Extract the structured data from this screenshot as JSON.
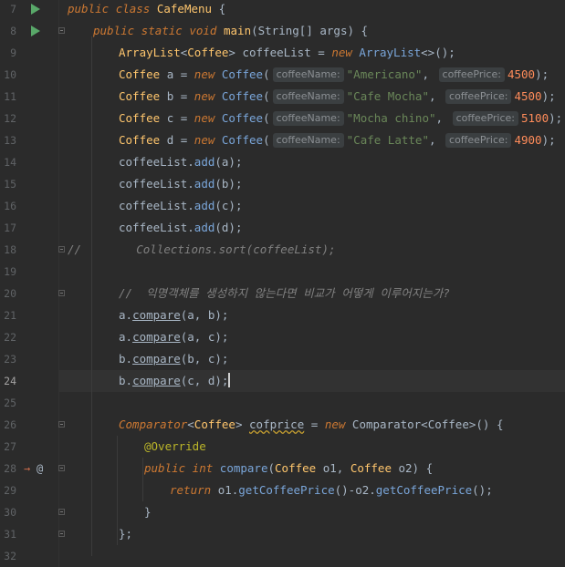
{
  "editor": {
    "current_line": 24,
    "lines": [
      {
        "n": "7",
        "tokens": [
          [
            "kw",
            "public "
          ],
          [
            "kw",
            "class "
          ],
          [
            "fn",
            "CafeMenu"
          ],
          [
            "gen",
            " {"
          ]
        ]
      },
      {
        "n": "8",
        "tokens": [
          [
            "kw",
            "public static void "
          ],
          [
            "fn",
            "main"
          ],
          [
            "gen",
            "(String[] args) {"
          ]
        ]
      },
      {
        "n": "9",
        "tokens": [
          [
            "typ",
            "ArrayList"
          ],
          [
            "gen",
            "<"
          ],
          [
            "typ",
            "Coffee"
          ],
          [
            "gen",
            "> coffeeList = "
          ],
          [
            "kw",
            "new "
          ],
          [
            "blue",
            "ArrayList"
          ],
          [
            "gen",
            "<>();"
          ]
        ]
      },
      {
        "n": "10",
        "tokens": [
          [
            "typ",
            "Coffee "
          ],
          [
            "gen",
            "a = "
          ],
          [
            "kw",
            "new "
          ],
          [
            "blue",
            "Coffee"
          ],
          [
            "gen",
            "("
          ],
          [
            "hint",
            "coffeeName:"
          ],
          [
            "str",
            "\"Americano\""
          ],
          [
            "gen",
            ", "
          ],
          [
            "hint",
            "coffeePrice:"
          ],
          [
            "num",
            "4500"
          ],
          [
            "gen",
            ");"
          ]
        ]
      },
      {
        "n": "11",
        "tokens": [
          [
            "typ",
            "Coffee "
          ],
          [
            "gen",
            "b = "
          ],
          [
            "kw",
            "new "
          ],
          [
            "blue",
            "Coffee"
          ],
          [
            "gen",
            "("
          ],
          [
            "hint",
            "coffeeName:"
          ],
          [
            "str",
            "\"Cafe Mocha\""
          ],
          [
            "gen",
            ", "
          ],
          [
            "hint",
            "coffeePrice:"
          ],
          [
            "num",
            "4500"
          ],
          [
            "gen",
            ");"
          ]
        ]
      },
      {
        "n": "12",
        "tokens": [
          [
            "typ",
            "Coffee "
          ],
          [
            "gen",
            "c = "
          ],
          [
            "kw",
            "new "
          ],
          [
            "blue",
            "Coffee"
          ],
          [
            "gen",
            "("
          ],
          [
            "hint",
            "coffeeName:"
          ],
          [
            "str",
            "\"Mocha chino\""
          ],
          [
            "gen",
            ", "
          ],
          [
            "hint",
            "coffeePrice:"
          ],
          [
            "num",
            "5100"
          ],
          [
            "gen",
            ");"
          ]
        ]
      },
      {
        "n": "13",
        "tokens": [
          [
            "typ",
            "Coffee "
          ],
          [
            "gen",
            "d = "
          ],
          [
            "kw",
            "new "
          ],
          [
            "blue",
            "Coffee"
          ],
          [
            "gen",
            "("
          ],
          [
            "hint",
            "coffeeName:"
          ],
          [
            "str",
            "\"Cafe Latte\""
          ],
          [
            "gen",
            ", "
          ],
          [
            "hint",
            "coffeePrice:"
          ],
          [
            "num",
            "4900"
          ],
          [
            "gen",
            ");"
          ]
        ]
      },
      {
        "n": "14",
        "tokens": [
          [
            "gen",
            "coffeeList."
          ],
          [
            "blue",
            "add"
          ],
          [
            "gen",
            "(a);"
          ]
        ]
      },
      {
        "n": "15",
        "tokens": [
          [
            "gen",
            "coffeeList."
          ],
          [
            "blue",
            "add"
          ],
          [
            "gen",
            "(b);"
          ]
        ]
      },
      {
        "n": "16",
        "tokens": [
          [
            "gen",
            "coffeeList."
          ],
          [
            "blue",
            "add"
          ],
          [
            "gen",
            "(c);"
          ]
        ]
      },
      {
        "n": "17",
        "tokens": [
          [
            "gen",
            "coffeeList."
          ],
          [
            "blue",
            "add"
          ],
          [
            "gen",
            "(d);"
          ]
        ]
      },
      {
        "n": "18",
        "tokens": [
          [
            "cmt",
            "//        Collections.sort(coffeeList);"
          ]
        ]
      },
      {
        "n": "19",
        "tokens": []
      },
      {
        "n": "20",
        "tokens": [
          [
            "cmt",
            "//  익명객체를 생성하지 않는다면 비교가 어떻게 이루어지는가?"
          ]
        ]
      },
      {
        "n": "21",
        "tokens": [
          [
            "gen",
            "a."
          ],
          [
            "under",
            "compare"
          ],
          [
            "gen",
            "(a, b);"
          ]
        ]
      },
      {
        "n": "22",
        "tokens": [
          [
            "gen",
            "a."
          ],
          [
            "under",
            "compare"
          ],
          [
            "gen",
            "(a, c);"
          ]
        ]
      },
      {
        "n": "23",
        "tokens": [
          [
            "gen",
            "b."
          ],
          [
            "under",
            "compare"
          ],
          [
            "gen",
            "(b, c);"
          ]
        ]
      },
      {
        "n": "24",
        "tokens": [
          [
            "gen",
            "b."
          ],
          [
            "under",
            "compare"
          ],
          [
            "gen",
            "(c, d);"
          ],
          [
            "caret",
            ""
          ]
        ]
      },
      {
        "n": "25",
        "tokens": []
      },
      {
        "n": "26",
        "tokens": [
          [
            "kw",
            "Comparator"
          ],
          [
            "gen",
            "<"
          ],
          [
            "typ",
            "Coffee"
          ],
          [
            "gen",
            "> "
          ],
          [
            "squig",
            "cofprice"
          ],
          [
            "gen",
            " = "
          ],
          [
            "kw",
            "new "
          ],
          [
            "gen",
            "Comparator<Coffee>() {"
          ]
        ]
      },
      {
        "n": "27",
        "tokens": [
          [
            "ann",
            "@Override"
          ]
        ]
      },
      {
        "n": "28",
        "tokens": [
          [
            "kw",
            "public int "
          ],
          [
            "blue",
            "compare"
          ],
          [
            "gen",
            "("
          ],
          [
            "typ",
            "Coffee "
          ],
          [
            "gen",
            "o1, "
          ],
          [
            "typ",
            "Coffee "
          ],
          [
            "gen",
            "o2) {"
          ]
        ]
      },
      {
        "n": "29",
        "tokens": [
          [
            "kw",
            "return "
          ],
          [
            "gen",
            "o1."
          ],
          [
            "blue",
            "getCoffeePrice"
          ],
          [
            "gen",
            "()-o2."
          ],
          [
            "blue",
            "getCoffeePrice"
          ],
          [
            "gen",
            "();"
          ]
        ]
      },
      {
        "n": "30",
        "tokens": [
          [
            "gen",
            "}"
          ]
        ]
      },
      {
        "n": "31",
        "tokens": [
          [
            "gen",
            "};"
          ]
        ]
      },
      {
        "n": "32",
        "tokens": []
      }
    ]
  },
  "icons": {
    "run": "run-gutter-icon",
    "fold": "fold-marker-icon",
    "bulb": "intention-bulb-icon",
    "implements": "implements-method-icon",
    "override": "override-method-icon"
  },
  "colors": {
    "background": "#2b2b2b",
    "keyword": "#cc7832",
    "string": "#6a8759",
    "number": "#ff8c5a",
    "function": "#ffc66d",
    "comment": "#808080",
    "annotation": "#bbb529"
  }
}
